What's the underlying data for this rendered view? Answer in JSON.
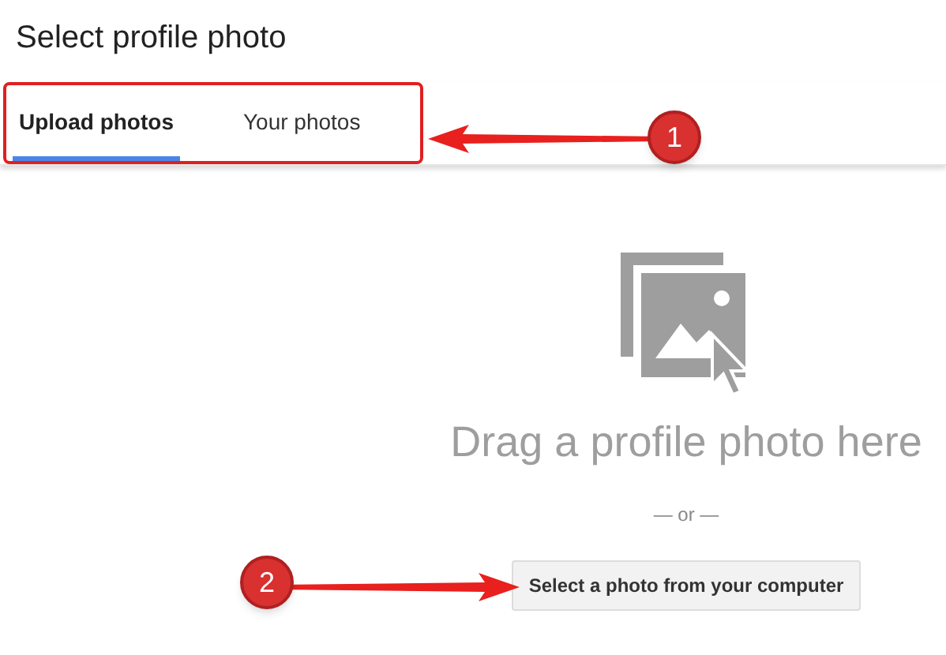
{
  "dialog": {
    "title": "Select profile photo"
  },
  "tabs": [
    {
      "label": "Upload photos",
      "selected": true
    },
    {
      "label": "Your photos",
      "selected": false
    }
  ],
  "upload": {
    "heading": "Drag a profile photo here",
    "separator": "— or —",
    "button": "Select a photo from your computer"
  },
  "callouts": [
    {
      "number": "1"
    },
    {
      "number": "2"
    }
  ]
}
